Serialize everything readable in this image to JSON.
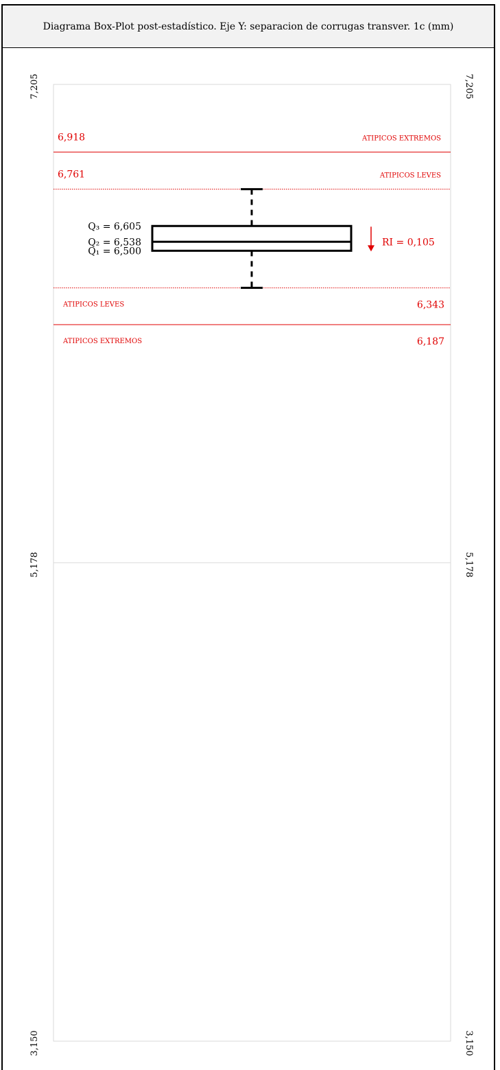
{
  "title": "Diagrama Box-Plot post-estadístico. Eje Y: separacion de corrugas transver. 1c (mm)",
  "chart_data": {
    "type": "boxplot",
    "ylim": [
      3.15,
      7.205
    ],
    "y_ticks": [
      "7,205",
      "5,178",
      "3,150"
    ],
    "y_tick_values": [
      7.205,
      5.178,
      3.15
    ],
    "box": {
      "whisker_high": 6.761,
      "q3": 6.605,
      "median": 6.538,
      "q1": 6.5,
      "whisker_low": 6.343
    },
    "fences": [
      {
        "value": 6.918,
        "value_label": "6,918",
        "label": "ATIPICOS EXTREMOS",
        "style": "solid"
      },
      {
        "value": 6.761,
        "value_label": "6,761",
        "label": "ATIPICOS LEVES",
        "style": "dotted"
      },
      {
        "value": 6.343,
        "value_label": "6,343",
        "label": "ATIPICOS LEVES",
        "style": "dotted"
      },
      {
        "value": 6.187,
        "value_label": "6,187",
        "label": "ATIPICOS EXTREMOS",
        "style": "solid"
      }
    ],
    "labels": {
      "q3": "Q₃ = 6,605",
      "q2": "Q₂ = 6,538",
      "q1": "Q₁ = 6,500",
      "ri": "RI = 0,105"
    },
    "colors": {
      "fence": "#e00000",
      "box": "#000000",
      "grid": "#d9d9d9"
    }
  }
}
